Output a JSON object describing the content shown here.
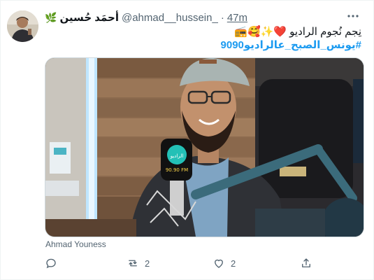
{
  "author": {
    "display_name": "أحمَد حُسين",
    "name_emoji": "🌿",
    "handle": "@ahmad__hussein_",
    "separator": "·",
    "time": "47m"
  },
  "tweet": {
    "text": "نِجم نُجوم الراديو ❤️✨🥰📻",
    "hashtag": "#يونس_الصبح_عالراديو9090"
  },
  "media": {
    "caption": "Ahmad Youness",
    "mic_logo_text": "الراديو",
    "mic_logo_sub": "90.90 FM"
  },
  "actions": {
    "reply_count": "",
    "retweet_count": "2",
    "like_count": "2"
  },
  "colors": {
    "accent": "#1d9bf0",
    "secondary_text": "#536471",
    "border": "#cfd9de"
  }
}
